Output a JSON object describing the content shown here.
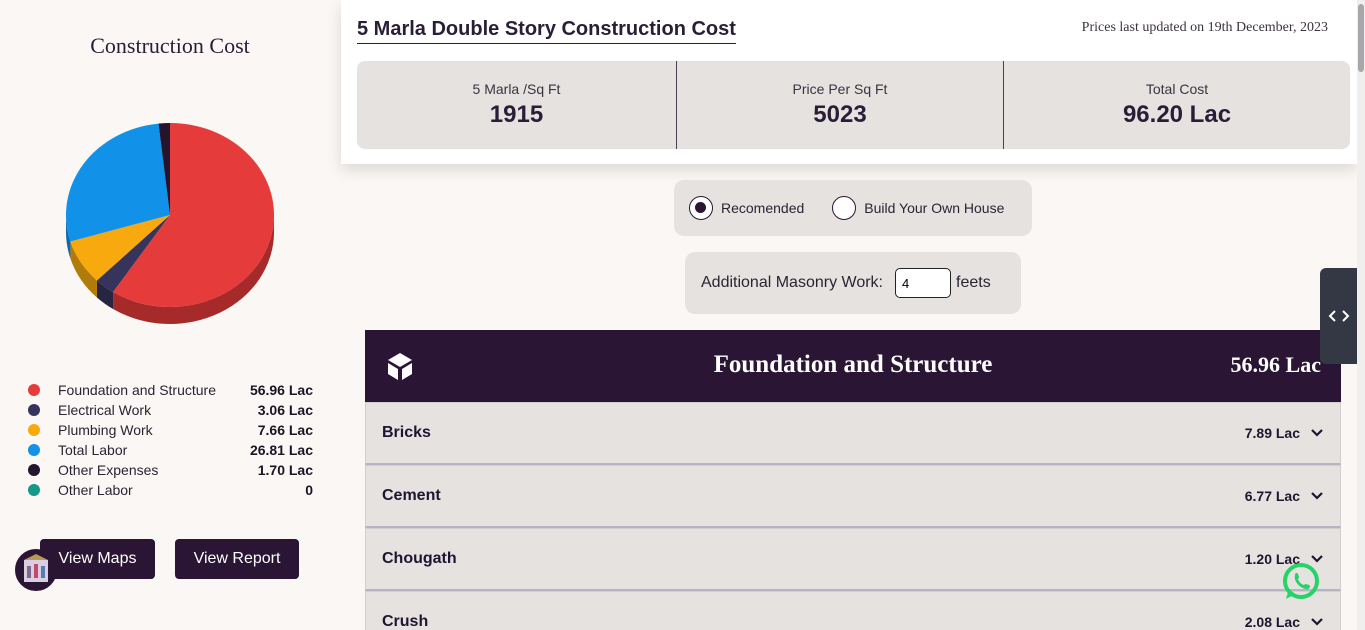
{
  "sidebar": {
    "title": "Construction Cost",
    "legend": [
      {
        "label": "Foundation and Structure",
        "value": "56.96 Lac",
        "color": "#e63b3b"
      },
      {
        "label": "Electrical Work",
        "value": "3.06 Lac",
        "color": "#36345a"
      },
      {
        "label": "Plumbing Work",
        "value": "7.66 Lac",
        "color": "#f7a90d"
      },
      {
        "label": "Total Labor",
        "value": "26.81 Lac",
        "color": "#1192e8"
      },
      {
        "label": "Other Expenses",
        "value": "1.70 Lac",
        "color": "#24142e"
      },
      {
        "label": "Other Labor",
        "value": "0",
        "color": "#14988a"
      }
    ],
    "buttons": {
      "view_maps": "View Maps",
      "view_report": "View Report"
    }
  },
  "header": {
    "title": "5 Marla Double Story Construction Cost",
    "updated": "Prices last updated on 19th December, 2023",
    "stats": [
      {
        "label": "5 Marla /Sq Ft",
        "value": "1915"
      },
      {
        "label": "Price Per Sq Ft",
        "value": "5023"
      },
      {
        "label": "Total Cost",
        "value": "96.20 Lac"
      }
    ]
  },
  "options": {
    "recommended": "Recomended",
    "build_own": "Build Your Own House",
    "selected": "recommended"
  },
  "masonry": {
    "label": "Additional Masonry Work:",
    "value": "4",
    "unit": "feets"
  },
  "section": {
    "title": "Foundation and Structure",
    "amount": "56.96 Lac",
    "icon": "cube-icon",
    "items": [
      {
        "name": "Bricks",
        "amount": "7.89 Lac"
      },
      {
        "name": "Cement",
        "amount": "6.77 Lac"
      },
      {
        "name": "Chougath",
        "amount": "1.20 Lac"
      },
      {
        "name": "Crush",
        "amount": "2.08 Lac"
      }
    ]
  },
  "chart_data": {
    "type": "pie",
    "categories": [
      "Foundation and Structure",
      "Electrical Work",
      "Plumbing Work",
      "Total Labor",
      "Other Expenses",
      "Other Labor"
    ],
    "values": [
      56.96,
      3.06,
      7.66,
      26.81,
      1.7,
      0
    ],
    "colors": [
      "#e63b3b",
      "#36345a",
      "#f7a90d",
      "#1192e8",
      "#24142e",
      "#14988a"
    ],
    "style": "3d"
  }
}
